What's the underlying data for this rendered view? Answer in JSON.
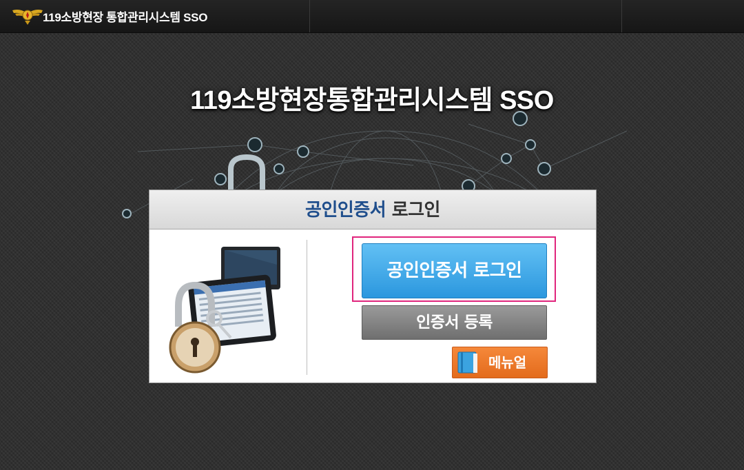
{
  "topbar": {
    "title": "119소방현장 통합관리시스템 SSO",
    "logo_icon": "fire-department-emblem-icon"
  },
  "main": {
    "title": "119소방현장통합관리시스템 SSO"
  },
  "panel": {
    "header_strong": "공인인증서",
    "header_rest": " 로그인",
    "illustration_icon": "padlock-devices-illustration-icon"
  },
  "buttons": {
    "cert_login": "공인인증서 로그인",
    "cert_register": "인증서 등록",
    "manual": "메뉴얼",
    "manual_icon": "book-icon"
  },
  "colors": {
    "accent_blue": "#2b97de",
    "highlight_magenta": "#e0247c",
    "manual_orange": "#e36b1c",
    "header_blue": "#1f4e8c"
  }
}
